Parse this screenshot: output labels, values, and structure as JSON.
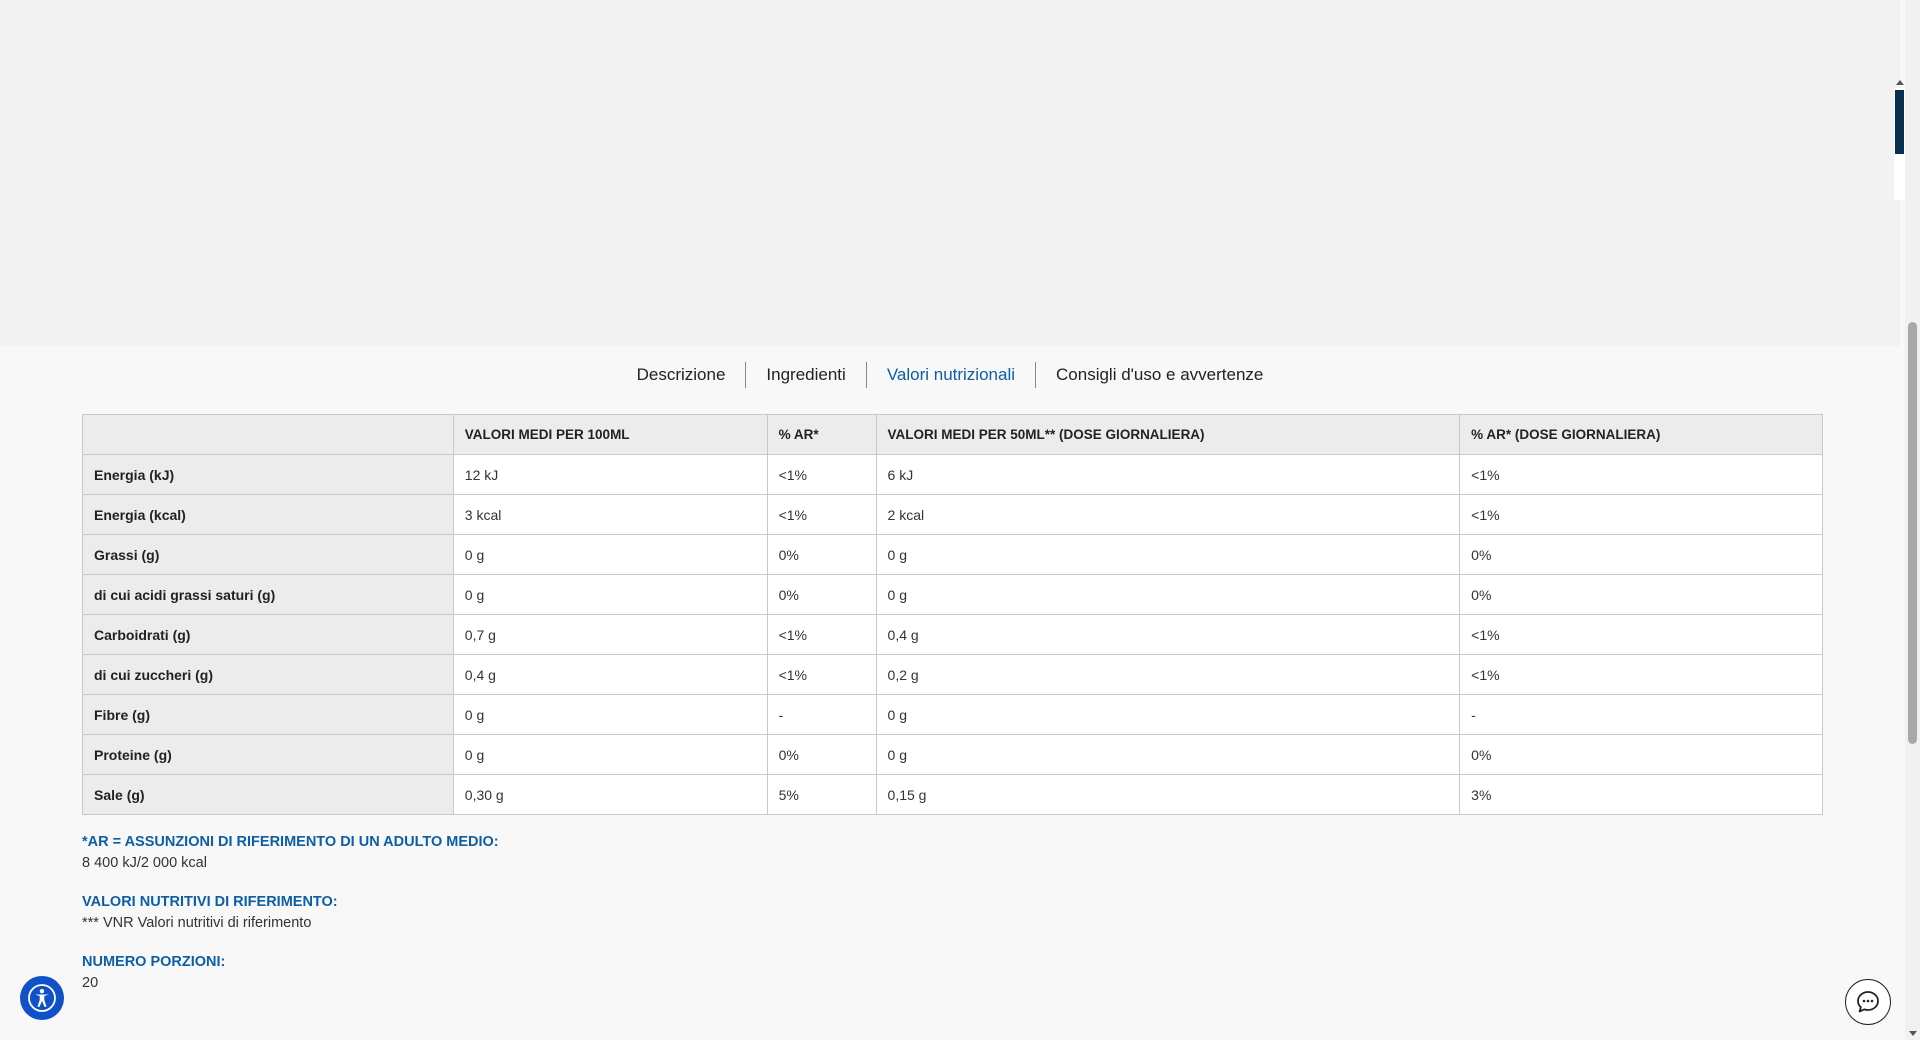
{
  "tabs": [
    {
      "label": "Descrizione",
      "active": false
    },
    {
      "label": "Ingredienti",
      "active": false
    },
    {
      "label": "Valori nutrizionali",
      "active": true
    },
    {
      "label": "Consigli d'uso e avvertenze",
      "active": false
    }
  ],
  "table": {
    "headers": [
      "",
      "VALORI MEDI PER 100ML",
      "% AR*",
      "VALORI MEDI PER 50ML** (DOSE GIORNALIERA)",
      "% AR* (DOSE GIORNALIERA)"
    ],
    "rows": [
      [
        "Energia (kJ)",
        "12 kJ",
        "<1%",
        "6 kJ",
        "<1%"
      ],
      [
        "Energia (kcal)",
        "3 kcal",
        "<1%",
        "2 kcal",
        "<1%"
      ],
      [
        "Grassi (g)",
        "0 g",
        "0%",
        "0 g",
        "0%"
      ],
      [
        "di cui acidi grassi saturi (g)",
        "0 g",
        "0%",
        "0 g",
        "0%"
      ],
      [
        "Carboidrati (g)",
        "0,7 g",
        "<1%",
        "0,4 g",
        "<1%"
      ],
      [
        "di cui zuccheri (g)",
        "0,4 g",
        "<1%",
        "0,2 g",
        "<1%"
      ],
      [
        "Fibre (g)",
        "0 g",
        "-",
        "0 g",
        "-"
      ],
      [
        "Proteine (g)",
        "0 g",
        "0%",
        "0 g",
        "0%"
      ],
      [
        "Sale (g)",
        "0,30 g",
        "5%",
        "0,15 g",
        "3%"
      ]
    ]
  },
  "notes": [
    {
      "title": "*AR = ASSUNZIONI DI RIFERIMENTO DI UN ADULTO MEDIO:",
      "value": "8 400 kJ/2 000 kcal"
    },
    {
      "title": "VALORI NUTRITIVI DI RIFERIMENTO:",
      "value": "*** VNR Valori nutritivi di riferimento"
    },
    {
      "title": "NUMERO PORZIONI:",
      "value": "20"
    }
  ],
  "icons": {
    "accessibility": "accessibility-icon",
    "chat": "chat-icon"
  },
  "colors": {
    "accent": "#0d5ea6",
    "accessibility_button": "#1050c8"
  }
}
